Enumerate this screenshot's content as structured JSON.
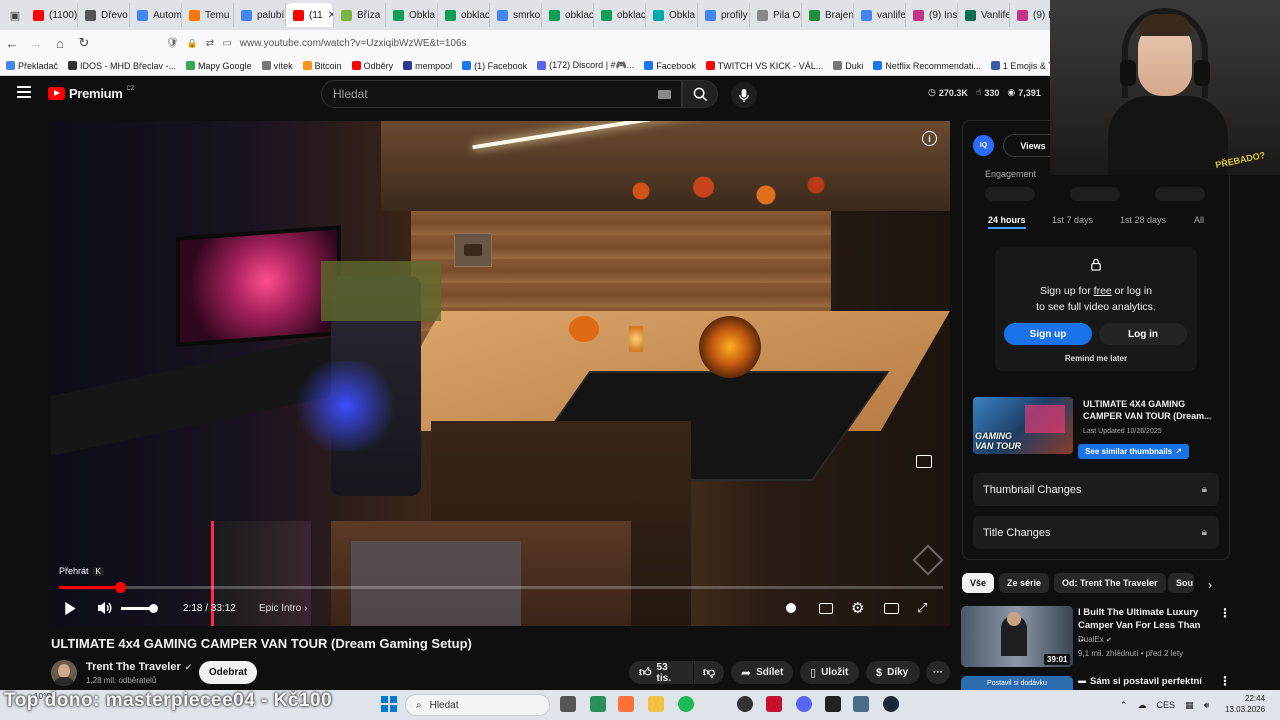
{
  "browser": {
    "tabs": [
      {
        "label": "(1100)",
        "color": "#ff0000"
      },
      {
        "label": "Dřevo",
        "color": "#555555"
      },
      {
        "label": "Autom",
        "color": "#4285f4"
      },
      {
        "label": "Temu",
        "color": "#fb7701"
      },
      {
        "label": "palubí",
        "color": "#4285f4"
      },
      {
        "label": "(11",
        "color": "#ff0000",
        "active": true
      },
      {
        "label": "Bříza",
        "color": "#7cb342"
      },
      {
        "label": "Obkla",
        "color": "#0f9d58"
      },
      {
        "label": "obklac",
        "color": "#0f9d58"
      },
      {
        "label": "smrko",
        "color": "#4285f4"
      },
      {
        "label": "obklac",
        "color": "#0f9d58"
      },
      {
        "label": "obklac",
        "color": "#0f9d58"
      },
      {
        "label": "Obkla",
        "color": "#0aa"
      },
      {
        "label": "profily",
        "color": "#4285f4"
      },
      {
        "label": "Pila Opluš",
        "color": "#888888"
      },
      {
        "label": "Brajen",
        "color": "#1e8e3e"
      },
      {
        "label": "vanlife",
        "color": "#4285f4"
      },
      {
        "label": "(9) Ins",
        "color": "#c13584"
      },
      {
        "label": "Vanlife",
        "color": "#0b6e4f"
      },
      {
        "label": "(9) Ins",
        "color": "#c13584"
      }
    ],
    "url": "www.youtube.com/watch?v=UzxiqibWzWE&t=106s",
    "bookmarks": [
      {
        "label": "Překladač",
        "color": "#4285f4"
      },
      {
        "label": "IDOS - MHD Břeclav -...",
        "color": "#333333"
      },
      {
        "label": "Mapy Google",
        "color": "#34a853"
      },
      {
        "label": "vítek",
        "color": "#777777"
      },
      {
        "label": "Bitcoin",
        "color": "#f7931a"
      },
      {
        "label": "Odběry",
        "color": "#ff0000"
      },
      {
        "label": "mempool",
        "color": "#2b3a8f"
      },
      {
        "label": "(1) Facebook",
        "color": "#1877f2"
      },
      {
        "label": "(172) Discord | #🎮...",
        "color": "#5865f2"
      },
      {
        "label": "Facebook",
        "color": "#1877f2"
      },
      {
        "label": "TWITCH VS KICK - VÁL...",
        "color": "#ff0000"
      },
      {
        "label": "Duki",
        "color": "#777777"
      },
      {
        "label": "Netflix Recommendati...",
        "color": "#1877f2"
      },
      {
        "label": "1 Emojis & Text | 1ツ...",
        "color": "#3b5ba5"
      },
      {
        "label": "Wa (S",
        "color": "#e50914"
      }
    ]
  },
  "youtube": {
    "logo": "Premium",
    "logo_region": "CZ",
    "search_placeholder": "Hledat",
    "stats": {
      "views": "270.3K",
      "likes": "330",
      "comments": "7,391"
    }
  },
  "player": {
    "tooltip_label": "Přehrát",
    "tooltip_key": "K",
    "time": "2:18 / 33:12",
    "chapter": "Epic Intro",
    "progress_fraction": 0.069,
    "volume_fraction": 1.0
  },
  "video": {
    "title": "ULTIMATE 4x4 GAMING CAMPER VAN TOUR (Dream Gaming Setup)",
    "channel": "Trent The Traveler",
    "subscribers": "1,28 mil. odběratelů",
    "subscribe_label": "Odebrat",
    "likes": "53 tis.",
    "share_label": "Sdílet",
    "save_label": "Uložit",
    "thanks_label": "Díky"
  },
  "analytics": {
    "badge": "IQ",
    "views_tab": "Views",
    "engagement_label": "Engagement",
    "time_tabs": [
      "24 hours",
      "1st 7 days",
      "1st 28 days",
      "All"
    ],
    "signup_line1_pre": "Sign up for ",
    "signup_line1_link": "free",
    "signup_line1_post": " or log in",
    "signup_line2": "to see full video analytics.",
    "signup_button": "Sign up",
    "login_button": "Log in",
    "remind_label": "Remind me later",
    "thumb_title": "ULTIMATE 4X4 GAMING CAMPER VAN TOUR (Dream...",
    "thumb_overlay": "GAMING VAN TOUR",
    "last_updated": "Last Updated 10/26/2025",
    "similar_button": "See similar thumbnails",
    "thumbnail_changes": "Thumbnail Changes",
    "title_changes": "Title Changes"
  },
  "chips": [
    "Vše",
    "Ze série",
    "Od: Trent The Traveler",
    "Sou"
  ],
  "recommendations": [
    {
      "title": "I Built The Ultimate Luxury Camper Van For Less Than ...",
      "channel": "DualEx",
      "meta": "9,1 mil. zhlédnutí • před 2 lety",
      "duration": "39:01"
    },
    {
      "title": "Sám si postavil perfektní",
      "thumb_text": "Postavil si dodávku",
      "channel": "",
      "meta": "",
      "duration": ""
    }
  ],
  "taskbar": {
    "overlay_text": "Top dono: masterpiecee04 - Kč100",
    "weather": "10°C",
    "search_placeholder": "Hledat",
    "language": "CES",
    "time": "22:44",
    "date": "13.03.2026"
  },
  "webcam": {
    "cap_text": "PŘEBADO?"
  }
}
